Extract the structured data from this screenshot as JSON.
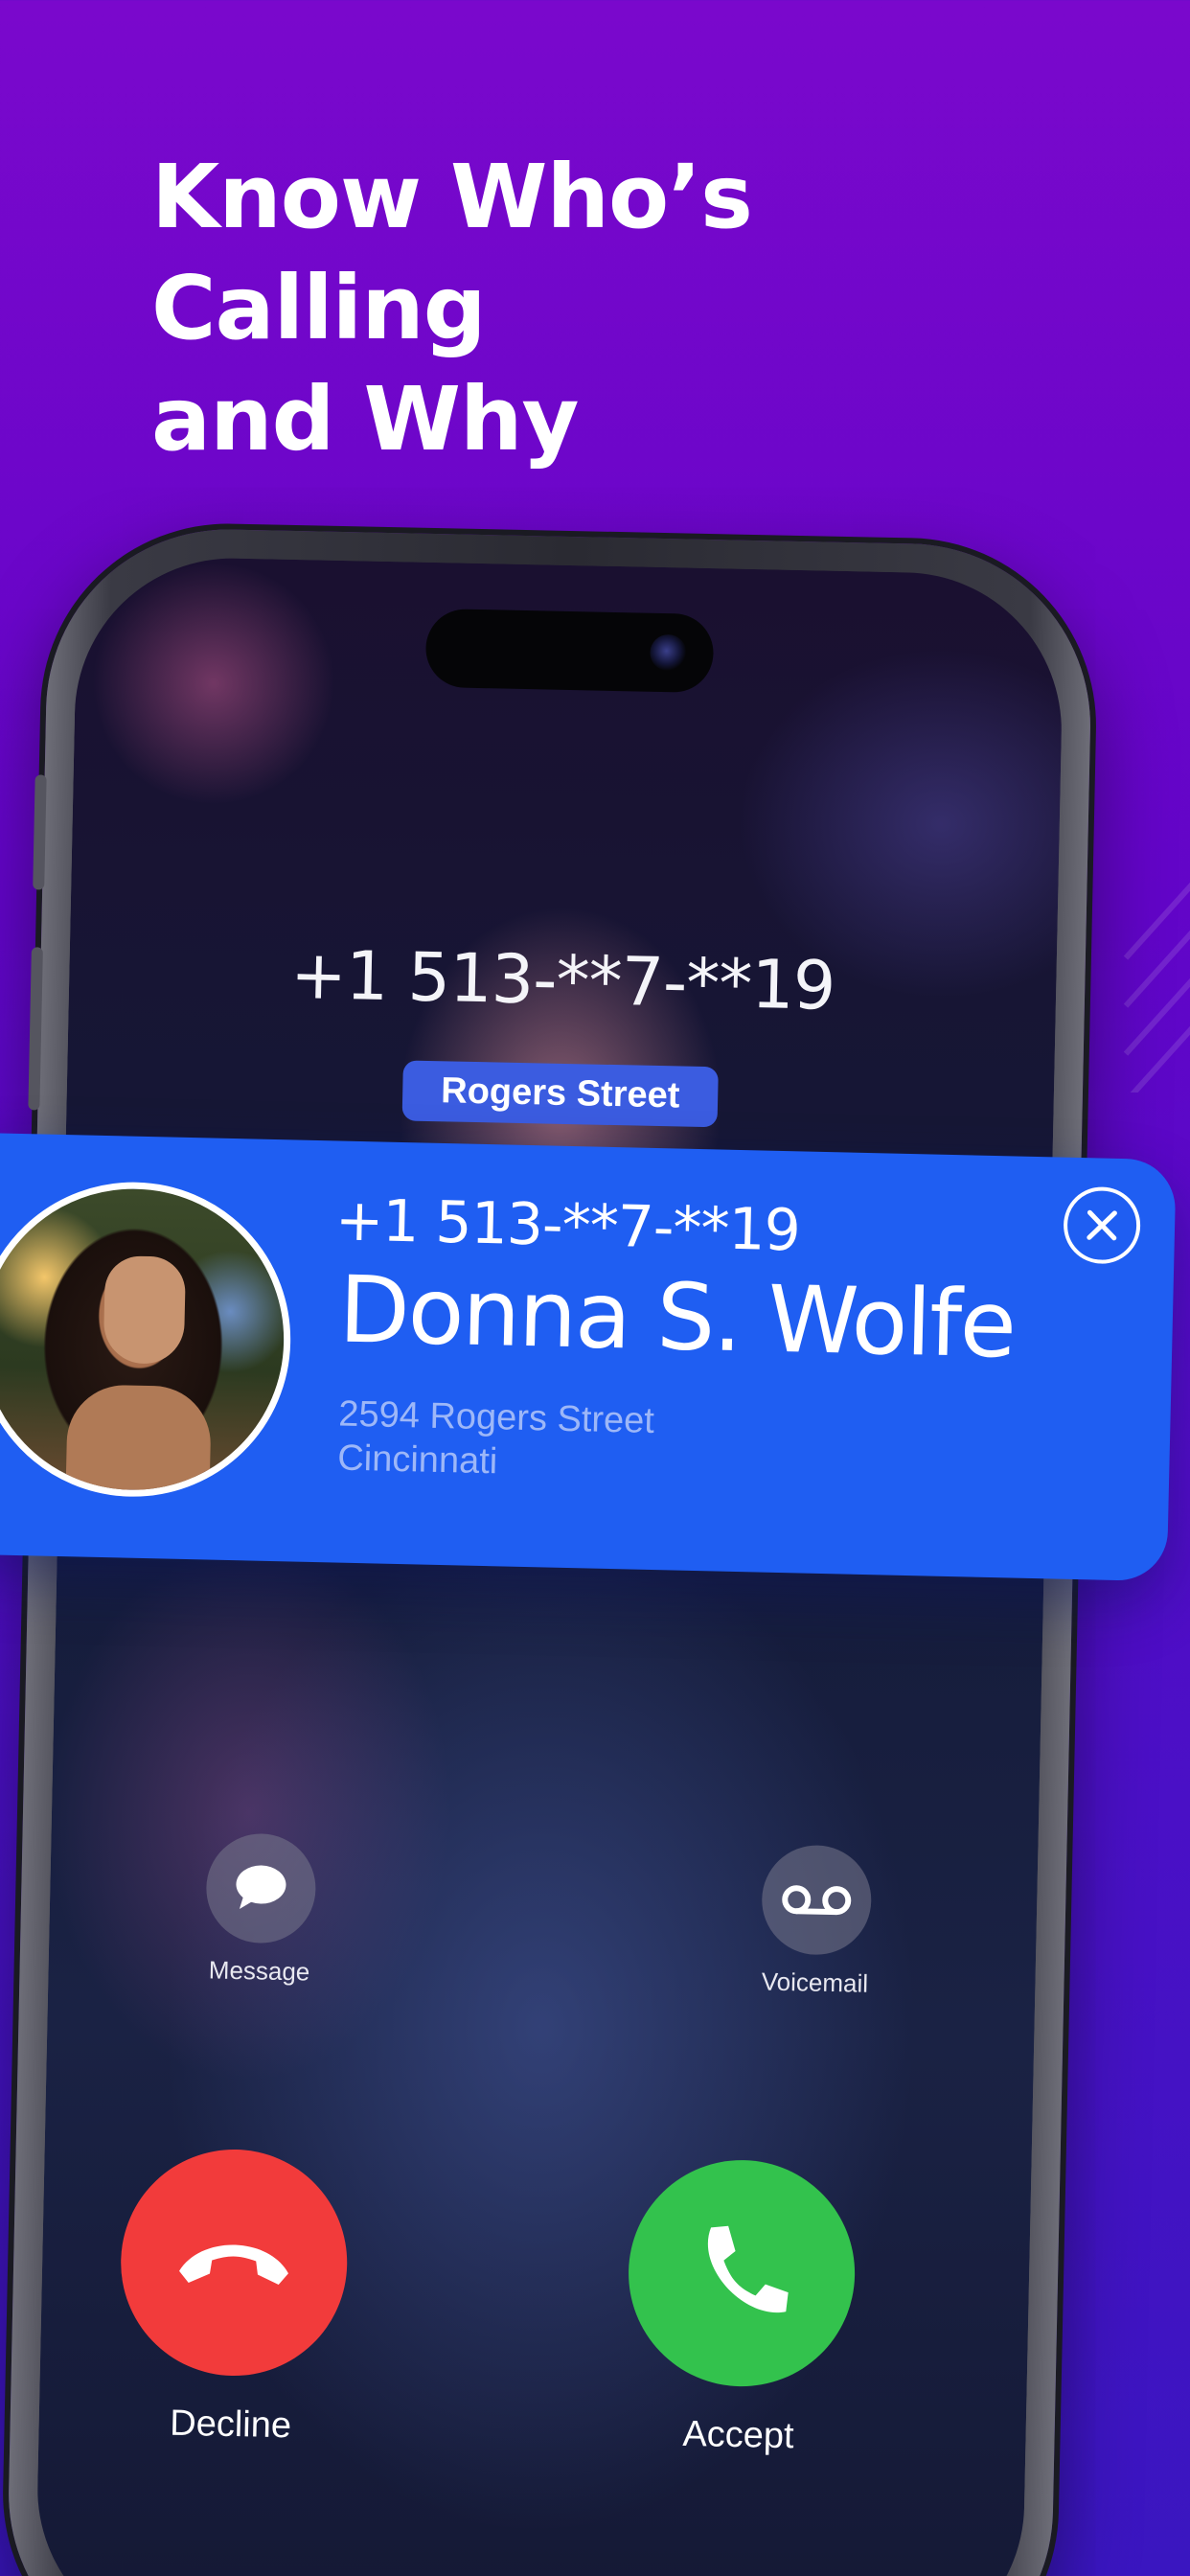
{
  "headline": {
    "line1": "Know Who’s Calling",
    "line2": "and Why"
  },
  "incoming_call": {
    "number": "+1 513-**7-**19",
    "location_tag": "Rogers Street"
  },
  "caller_card": {
    "number": "+1 513-**7-**19",
    "name": "Donna S. Wolfe",
    "address_line1": "2594 Rogers Street",
    "address_line2": "Cincinnati"
  },
  "actions": {
    "message_label": "Message",
    "voicemail_label": "Voicemail",
    "decline_label": "Decline",
    "accept_label": "Accept"
  },
  "colors": {
    "background": "#6a06cb",
    "card": "#1f5ef2",
    "decline": "#f23b3b",
    "accept": "#33c24d",
    "street_pill": "#3b5ce0"
  },
  "icons": [
    "message-icon",
    "voicemail-icon",
    "decline-phone-icon",
    "accept-phone-icon",
    "close-icon"
  ]
}
